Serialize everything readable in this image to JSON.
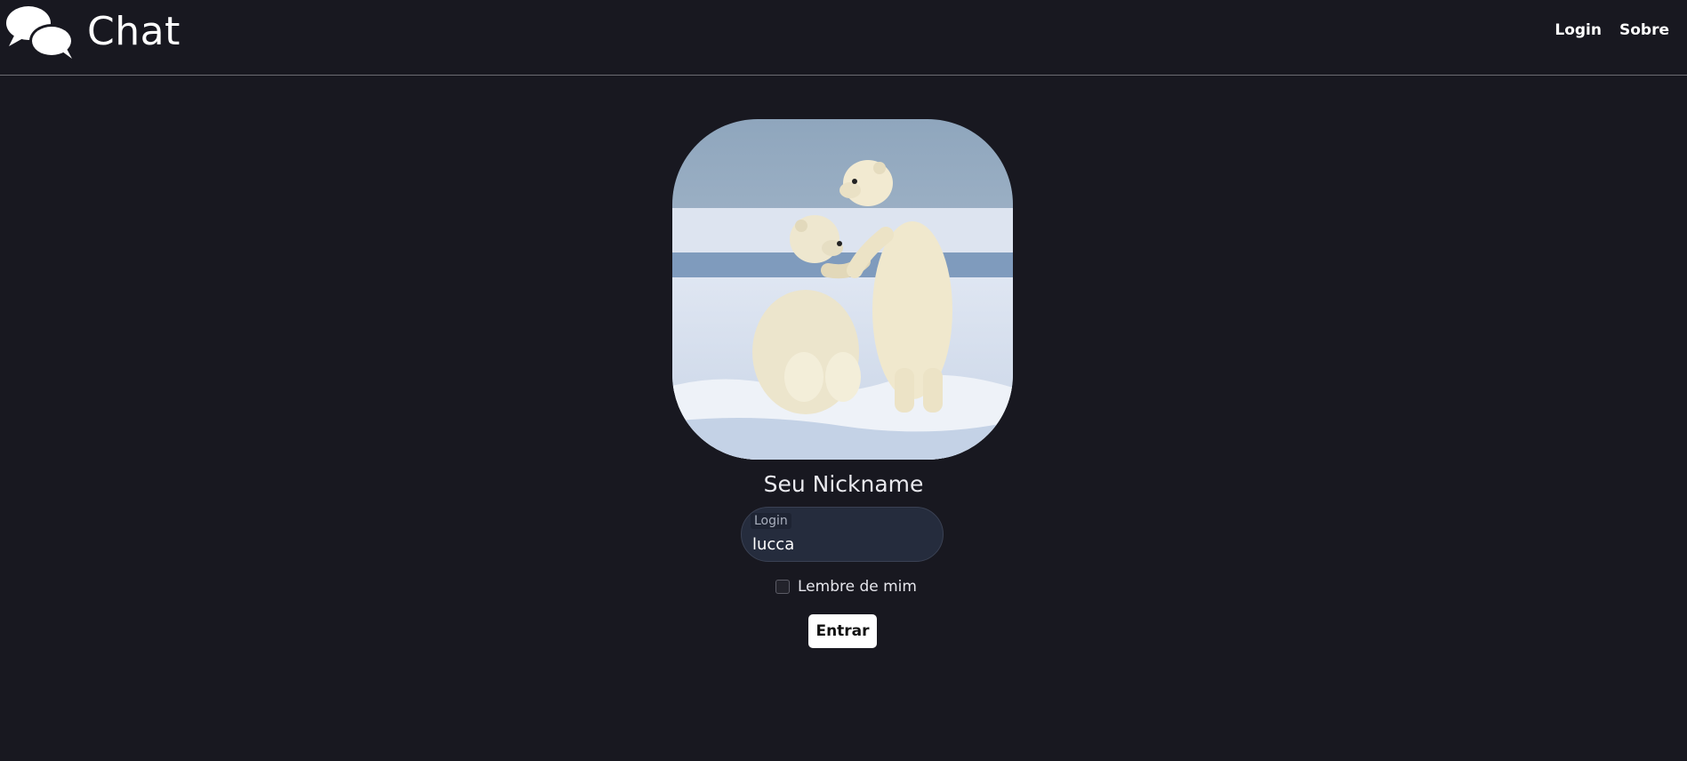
{
  "brand": {
    "title": "Chat",
    "icon": "chat-bubbles-icon"
  },
  "nav": {
    "login": "Login",
    "about": "Sobre"
  },
  "profile": {
    "image": "polar-bears-photo"
  },
  "form": {
    "nickname_label": "Seu Nickname",
    "login_label": "Login",
    "login_value": "lucca",
    "remember_label": "Lembre de mim",
    "remember_checked": false,
    "submit_label": "Entrar"
  },
  "colors": {
    "background": "#181820",
    "input_bg": "#252c3d",
    "button_bg": "#ffffff"
  }
}
